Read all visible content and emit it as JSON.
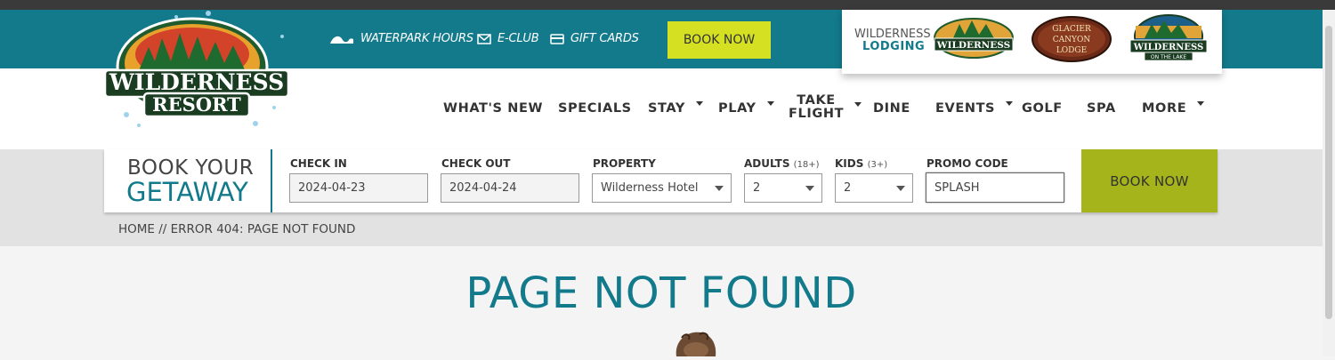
{
  "brand": {
    "logo_line1": "WILDERNESS",
    "logo_line2": "RESORT",
    "colors": {
      "teal": "#127a8b",
      "lime": "#d4e021",
      "olive": "#a4b41a"
    }
  },
  "utility": {
    "waterpark_hours": "WATERPARK HOURS",
    "eclub": "E-CLUB",
    "gift_cards": "GIFT CARDS",
    "book_now": "BOOK NOW"
  },
  "lodging": {
    "label_line1": "WILDERNESS",
    "label_line2": "LODGING",
    "badges": [
      {
        "name": "Wilderness",
        "line1": "WILDERNESS"
      },
      {
        "name": "Glacier Canyon Lodge",
        "line1": "GLACIER",
        "line2": "CANYON",
        "line3": "LODGE"
      },
      {
        "name": "Wilderness on the Lake",
        "line1": "WILDERNESS",
        "line2": "ON THE LAKE"
      }
    ]
  },
  "nav": {
    "items": [
      {
        "label": "WHAT'S NEW"
      },
      {
        "label": "SPECIALS"
      },
      {
        "label": "STAY"
      },
      {
        "label": "PLAY"
      },
      {
        "label_line1": "TAKE",
        "label_line2": "FLIGHT"
      },
      {
        "label": "DINE"
      },
      {
        "label": "EVENTS"
      },
      {
        "label": "GOLF"
      },
      {
        "label": "SPA"
      },
      {
        "label": "MORE"
      }
    ]
  },
  "booking": {
    "title_line1": "BOOK YOUR",
    "title_line2": "GETAWAY",
    "check_in_label": "CHECK IN",
    "check_in_value": "2024-04-23",
    "check_out_label": "CHECK OUT",
    "check_out_value": "2024-04-24",
    "property_label": "PROPERTY",
    "property_value": "Wilderness Hotel",
    "adults_label": "ADULTS",
    "adults_note": "(18+)",
    "adults_value": "2",
    "kids_label": "KIDS",
    "kids_note": "(3+)",
    "kids_value": "2",
    "promo_label": "PROMO CODE",
    "promo_value": "SPLASH",
    "book_now": "BOOK NOW"
  },
  "breadcrumb": "HOME // ERROR 404: PAGE NOT FOUND",
  "page_title": "PAGE NOT FOUND"
}
